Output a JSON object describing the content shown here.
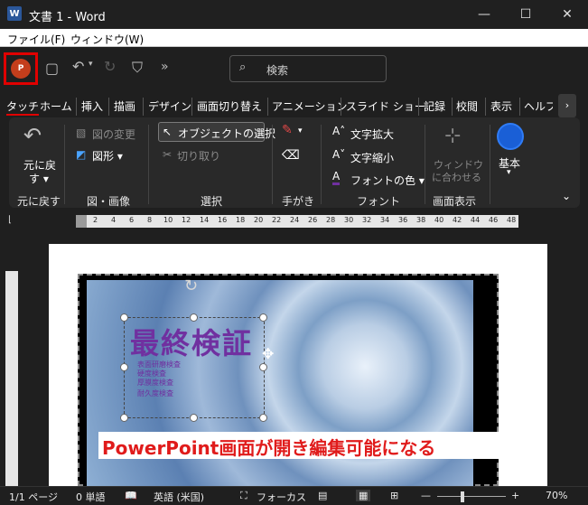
{
  "window": {
    "title": "文書 1 - Word",
    "app_icon": "W",
    "minimize": "—",
    "maximize": "☐",
    "close": "✕"
  },
  "menu": {
    "file": "ファイル(F)",
    "window": "ウィンドウ(W)"
  },
  "qat": {
    "search_placeholder": "検索",
    "more": "»"
  },
  "tabs": [
    "タッチ",
    "ホーム",
    "挿入",
    "描画",
    "デザイン",
    "画面切り替え",
    "アニメーション",
    "スライド ショー",
    "記録",
    "校閲",
    "表示",
    "ヘルプ"
  ],
  "ribbon": {
    "undo_label_1": "元に戻",
    "undo_label_2": "す ▾",
    "group_undo": "元に戻す",
    "change_image": "図の変更",
    "shape": "図形 ▾",
    "group_image": "図・画像",
    "select_object": "オブジェクトの選択",
    "crop": "切り取り",
    "group_select": "選択",
    "group_handwriting": "手がき",
    "font_grow": "文字拡大",
    "font_shrink": "文字縮小",
    "font_color": "フォントの色 ▾",
    "group_font": "フォント",
    "fit_window_1": "ウィンドウ",
    "fit_window_2": "に合わせる",
    "group_view": "画面表示",
    "basic": "基本"
  },
  "ruler": {
    "numbers": [
      "2",
      "4",
      "6",
      "8",
      "10",
      "12",
      "14",
      "16",
      "18",
      "20",
      "22",
      "24",
      "26",
      "28",
      "30",
      "32",
      "34",
      "36",
      "38",
      "40",
      "42",
      "44",
      "46",
      "48"
    ]
  },
  "slide": {
    "title": "最終検証",
    "bullets": [
      "表面研磨検査",
      "硬度検査",
      "厚膜度検査",
      "耐久度検査"
    ],
    "caption": "PowerPoint画面が開き編集可能になる"
  },
  "status": {
    "page": "1/1 ページ",
    "words": "0 単語",
    "language": "英語 (米国)",
    "focus": "フォーカス",
    "zoom": "70%"
  },
  "colors": {
    "accent": "#e00000",
    "slide_text": "#7030a0",
    "caption_text": "#e01b1b"
  }
}
